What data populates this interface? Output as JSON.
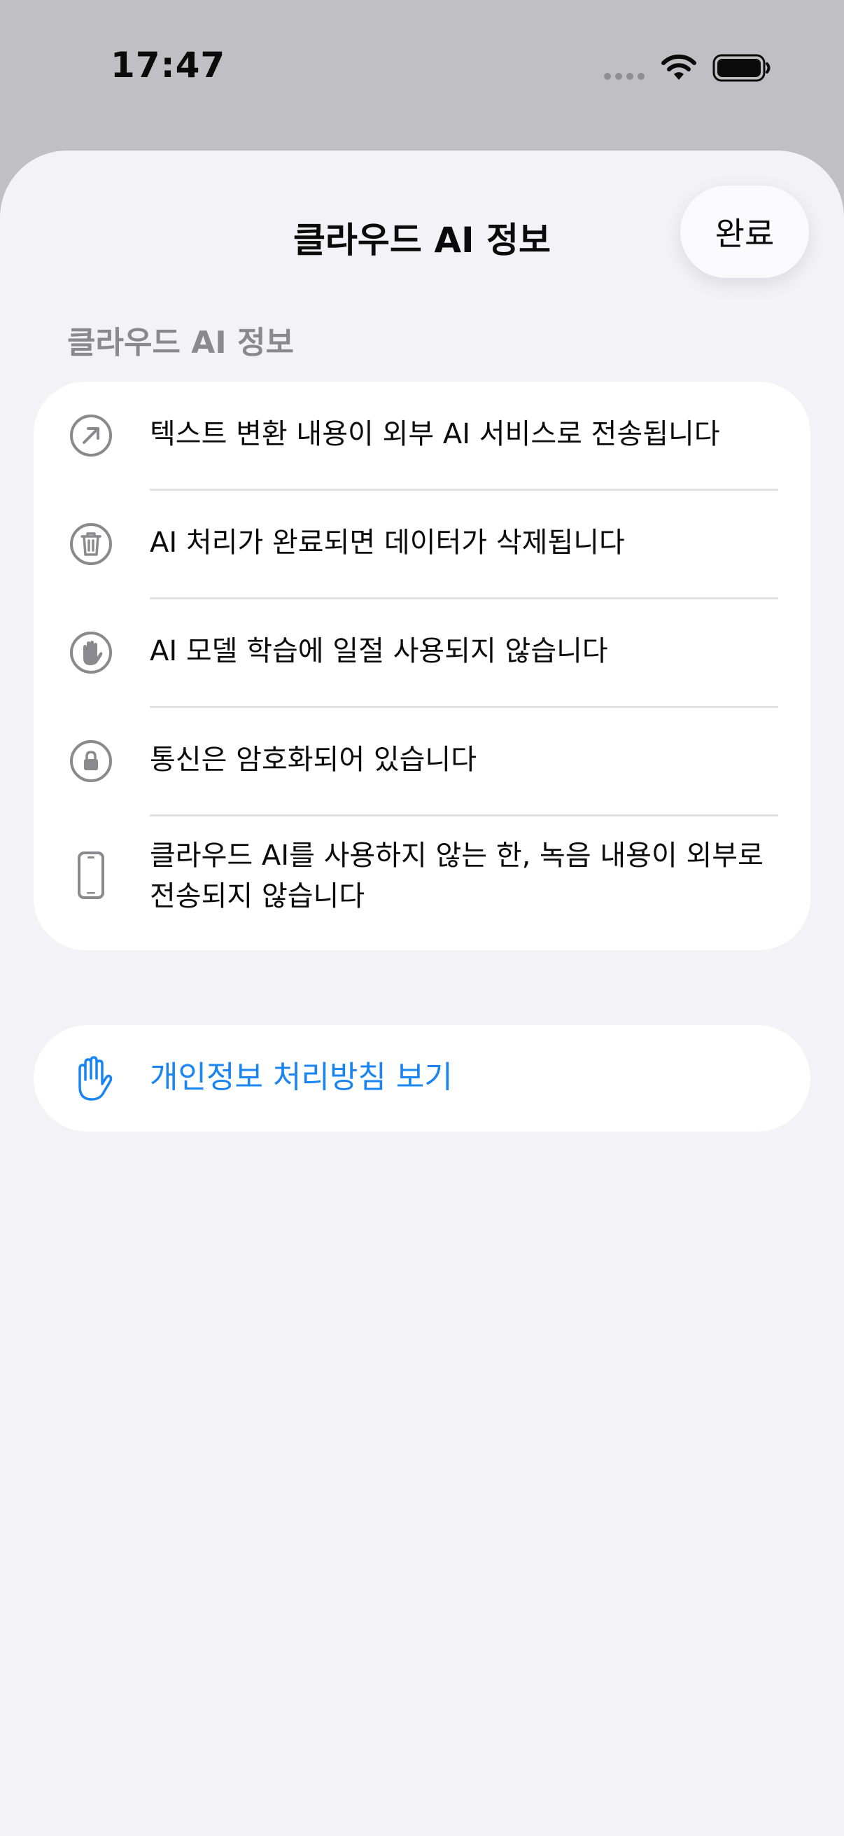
{
  "status_bar": {
    "time": "17:47"
  },
  "sheet": {
    "title": "클라우드 AI 정보",
    "done_label": "완료",
    "section_header": "클라우드 AI 정보"
  },
  "info_items": [
    {
      "icon": "arrow-up-right-icon",
      "text": "텍스트 변환 내용이 외부 AI 서비스로 전송됩니다"
    },
    {
      "icon": "trash-icon",
      "text": "AI 처리가 완료되면 데이터가 삭제됩니다"
    },
    {
      "icon": "hand-raised-icon",
      "text": "AI 모델 학습에 일절 사용되지 않습니다"
    },
    {
      "icon": "lock-icon",
      "text": "통신은 암호화되어 있습니다"
    },
    {
      "icon": "iphone-icon",
      "text": "클라우드 AI를 사용하지 않는 한, 녹음 내용이 외부로 전송되지 않습니다"
    }
  ],
  "privacy_link": {
    "icon": "hand-raised-icon",
    "label": "개인정보 처리방침 보기"
  },
  "colors": {
    "accent": "#1a84f0",
    "icon_gray": "#8a8a8e",
    "background": "#f2f2f7"
  }
}
